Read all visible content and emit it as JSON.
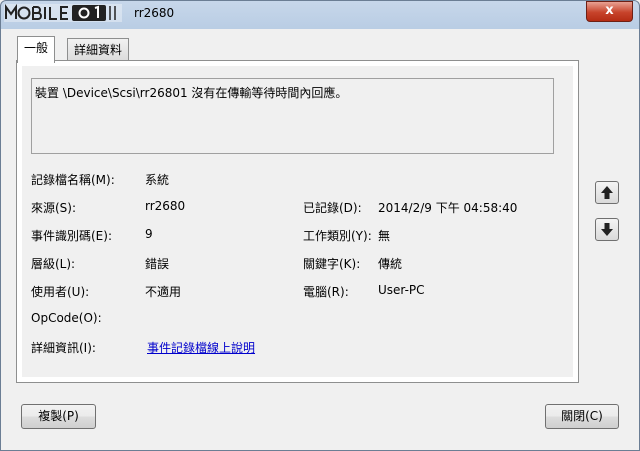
{
  "window": {
    "title": "rr2680",
    "close_label": "x"
  },
  "logo": {
    "text": "MOBILE01"
  },
  "tabs": [
    {
      "label": "一般"
    },
    {
      "label": "詳細資料"
    }
  ],
  "event": {
    "description": "裝置 \\Device\\Scsi\\rr26801 沒有在傳輸等待時間內回應。",
    "fields": {
      "log_name": {
        "label": "記錄檔名稱(M):",
        "value": "系統"
      },
      "source": {
        "label": "來源(S):",
        "value": "rr2680"
      },
      "logged": {
        "label": "已記錄(D):",
        "value": "2014/2/9 下午 04:58:40"
      },
      "event_id": {
        "label": "事件識別碼(E):",
        "value": "9"
      },
      "task": {
        "label": "工作類別(Y):",
        "value": "無"
      },
      "level": {
        "label": "層級(L):",
        "value": "錯誤"
      },
      "keywords": {
        "label": "關鍵字(K):",
        "value": "傳統"
      },
      "user": {
        "label": "使用者(U):",
        "value": "不適用"
      },
      "computer": {
        "label": "電腦(R):",
        "value": "User-PC"
      },
      "opcode": {
        "label": "OpCode(O):",
        "value": ""
      },
      "more_info": {
        "label": "詳細資訊(I):",
        "value": "事件記錄檔線上說明"
      }
    }
  },
  "buttons": {
    "copy": "複製(P)",
    "close": "關閉(C)"
  },
  "icons": {
    "up": "arrow-up-icon",
    "down": "arrow-down-icon"
  }
}
